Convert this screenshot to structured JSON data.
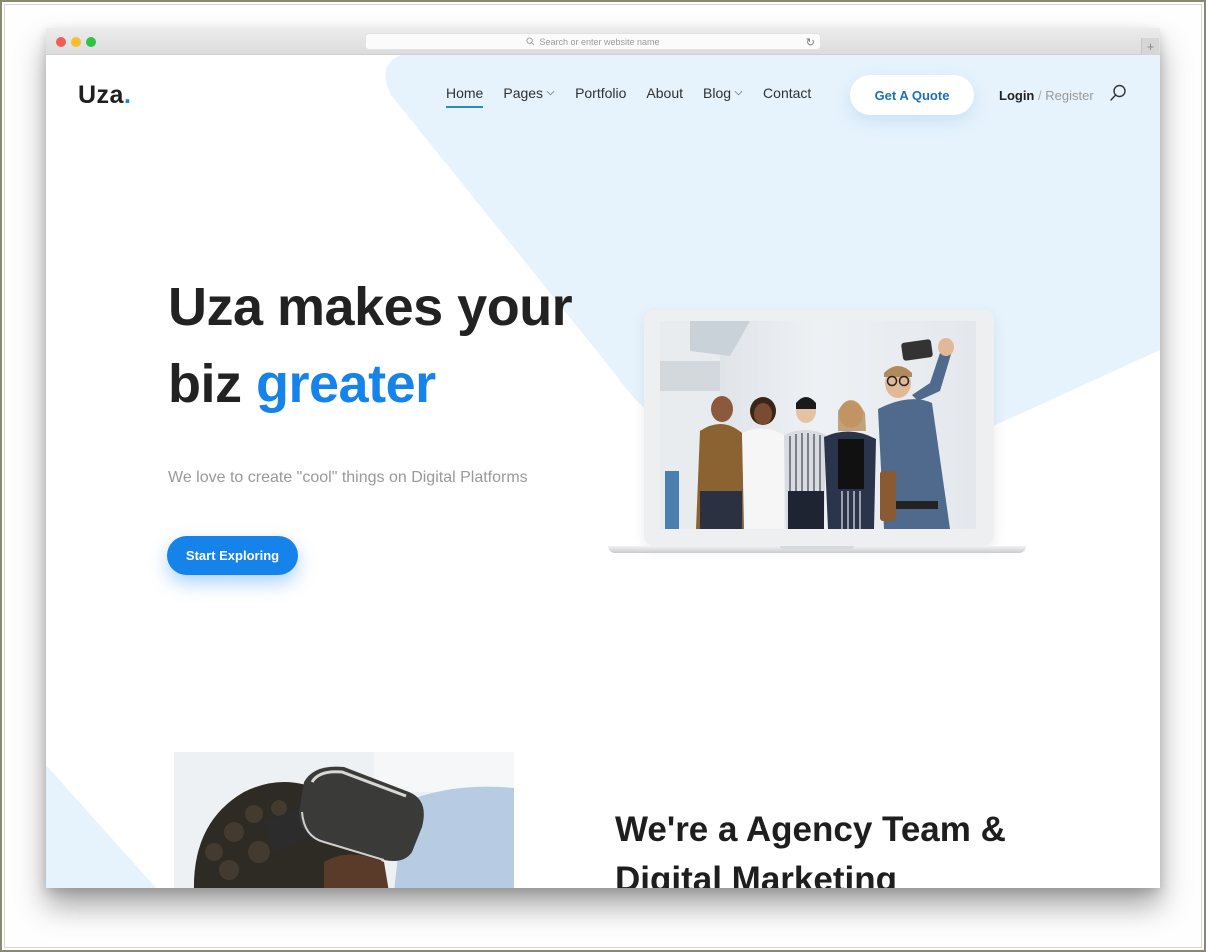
{
  "browser": {
    "url_placeholder": "Search or enter website name",
    "new_tab_label": "+"
  },
  "site": {
    "logo_text": "Uza",
    "logo_dot": ".",
    "brand_color": "#1583e9"
  },
  "nav": {
    "items": [
      {
        "label": "Home",
        "active": true,
        "has_dropdown": false
      },
      {
        "label": "Pages",
        "active": false,
        "has_dropdown": true
      },
      {
        "label": "Portfolio",
        "active": false,
        "has_dropdown": false
      },
      {
        "label": "About",
        "active": false,
        "has_dropdown": false
      },
      {
        "label": "Blog",
        "active": false,
        "has_dropdown": true
      },
      {
        "label": "Contact",
        "active": false,
        "has_dropdown": false
      }
    ],
    "quote_button": "Get A Quote",
    "login": "Login",
    "separator": "/",
    "register": "Register"
  },
  "hero": {
    "title_line1": "Uza makes your",
    "title_line2_plain": "biz",
    "title_line2_accent": "greater",
    "subtitle": "We love to create \"cool\" things on Digital Platforms",
    "cta_label": "Start Exploring",
    "image_alt": "Team taking a group selfie"
  },
  "about": {
    "title_line1": "We're a Agency Team &",
    "title_line2": "Digital Marketing",
    "image_alt": "Person wearing VR headset"
  }
}
